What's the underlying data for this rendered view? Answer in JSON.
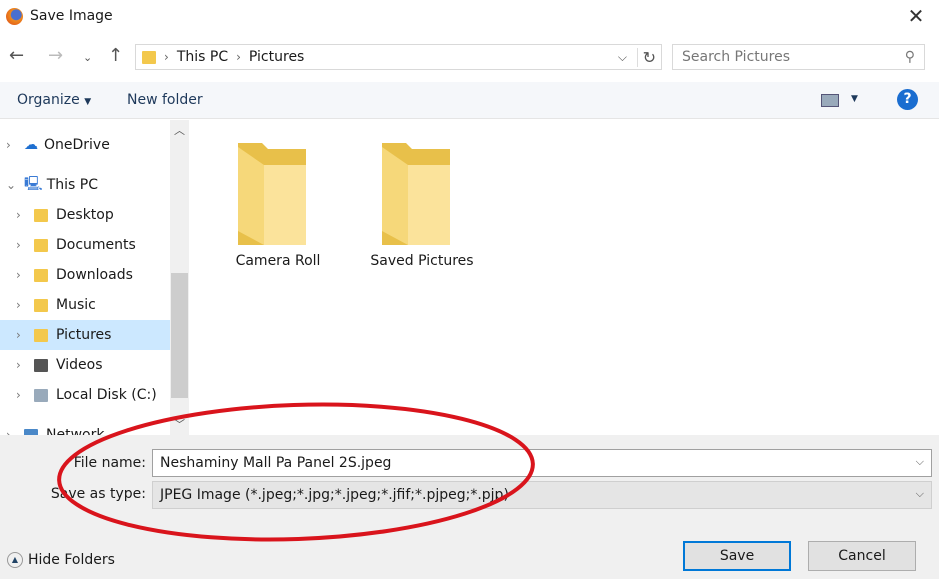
{
  "window": {
    "title": "Save Image"
  },
  "address": {
    "crumbs": [
      "This PC",
      "Pictures"
    ]
  },
  "search": {
    "placeholder": "Search Pictures"
  },
  "toolbar": {
    "organize": "Organize",
    "new_folder": "New folder",
    "help": "?"
  },
  "nav": [
    {
      "label": "OneDrive",
      "color": "#1e6fd0"
    },
    {
      "label": "This PC"
    },
    {
      "label": "Desktop"
    },
    {
      "label": "Documents"
    },
    {
      "label": "Downloads"
    },
    {
      "label": "Music"
    },
    {
      "label": "Pictures",
      "selected": true
    },
    {
      "label": "Videos"
    },
    {
      "label": "Local Disk (C:)"
    },
    {
      "label": "Network"
    }
  ],
  "folders": [
    {
      "name": "Camera Roll"
    },
    {
      "name": "Saved Pictures"
    }
  ],
  "form": {
    "file_name_label": "File name:",
    "file_name": "Neshaminy Mall Pa Panel 2S.jpeg",
    "type_label": "Save as type:",
    "type": "JPEG Image (*.jpeg;*.jpg;*.jpeg;*.jfif;*.pjpeg;*.pjp)"
  },
  "footer": {
    "hide_folders": "Hide Folders",
    "save": "Save",
    "cancel": "Cancel"
  },
  "annotation": {
    "color": "#d9141c"
  }
}
